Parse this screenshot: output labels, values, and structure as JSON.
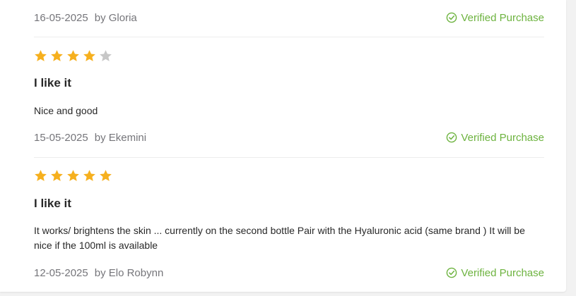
{
  "reviews": [
    {
      "date": "16-05-2025",
      "author": "by Gloria",
      "verified_label": "Verified Purchase"
    },
    {
      "rating": 4,
      "max_rating": 5,
      "title": "I like it",
      "body": "Nice and good",
      "date": "15-05-2025",
      "author": "by Ekemini",
      "verified_label": "Verified Purchase"
    },
    {
      "rating": 5,
      "max_rating": 5,
      "title": "I like it",
      "body": "It works/ brightens the skin ... currently on the second bottle Pair with the Hyaluronic acid (same brand ) It will be nice if the 100ml is available",
      "date": "12-05-2025",
      "author": "by Elo Robynn",
      "verified_label": "Verified Purchase"
    }
  ],
  "colors": {
    "star_filled": "#f6b01e",
    "star_empty": "#c7c7c7",
    "verified": "#6db33f"
  },
  "icons": {
    "star": "star-icon",
    "verified": "check-circle-icon"
  }
}
